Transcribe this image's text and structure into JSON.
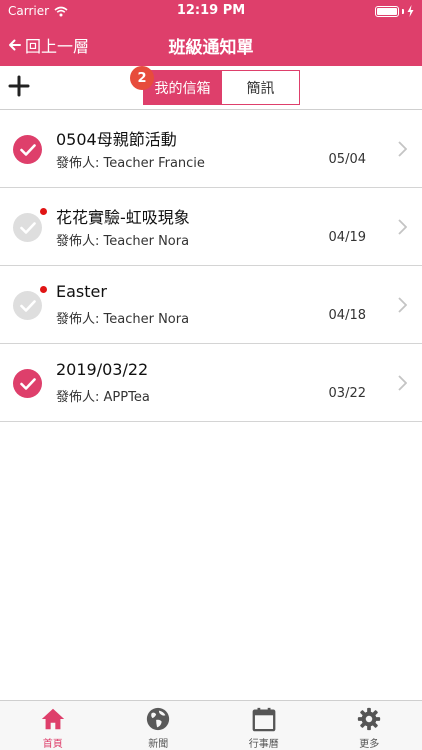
{
  "status_bar": {
    "carrier": "Carrier",
    "time": "12:19 PM"
  },
  "nav": {
    "back_label": "回上一層",
    "title": "班級通知單"
  },
  "segments": {
    "badge_count": "2",
    "inbox_label": "我的信箱",
    "sms_label": "簡訊"
  },
  "notices": [
    {
      "title": "0504母親節活動",
      "sender": "發佈人: Teacher Francie",
      "date": "05/04",
      "read": true
    },
    {
      "title": "花花實驗-虹吸現象",
      "sender": "發佈人: Teacher Nora",
      "date": "04/19",
      "read": false
    },
    {
      "title": "Easter",
      "sender": "發佈人: Teacher Nora",
      "date": "04/18",
      "read": false
    },
    {
      "title": "2019/03/22",
      "sender": "發佈人: APPTea",
      "date": "03/22",
      "read": true
    }
  ],
  "tabs": [
    {
      "label": "首頁",
      "icon": "home-icon"
    },
    {
      "label": "新聞",
      "icon": "globe-icon"
    },
    {
      "label": "行事曆",
      "icon": "calendar-icon"
    },
    {
      "label": "更多",
      "icon": "gear-icon"
    }
  ],
  "colors": {
    "accent": "#de3f6b",
    "badge": "#e74c3c",
    "unread_dot": "#e01515"
  }
}
